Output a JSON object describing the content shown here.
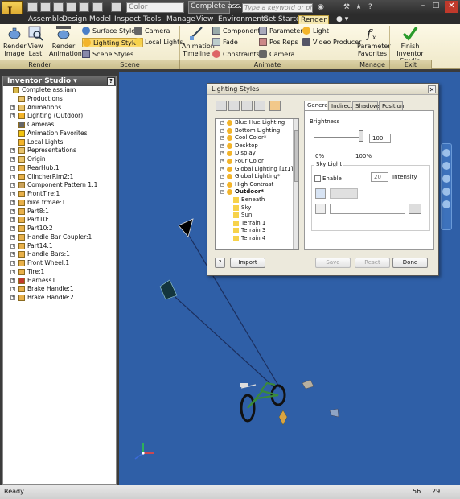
{
  "titlebar": {
    "app_logo": "I",
    "color_dropdown": "Color",
    "document_title": "Complete ass...",
    "search_placeholder": "Type a keyword or phrase",
    "minimize": "–",
    "maximize": "□",
    "close": "✕"
  },
  "tabs": [
    "Assemble",
    "Design",
    "Model",
    "Inspect",
    "Tools",
    "Manage",
    "View",
    "Environments",
    "Get Started",
    "Render"
  ],
  "ribbon": {
    "render_image": [
      "Render",
      "Image"
    ],
    "view_last": [
      "View",
      "Last"
    ],
    "render_animation": [
      "Render",
      "Animation"
    ],
    "surface_styles": "Surface Styles",
    "lighting_styles": "Lighting Styles",
    "scene_styles": "Scene Styles",
    "camera": "Camera",
    "local_lights": "Local Lights",
    "animation_timeline": [
      "Animation",
      "Timeline"
    ],
    "components": "Components",
    "fade": "Fade",
    "constraints": "Constraints",
    "parameters": "Parameters",
    "pos_reps": "Pos Reps",
    "camera2": "Camera",
    "light": "Light",
    "video_producer": "Video Producer",
    "parameter_favorites": [
      "Parameter",
      "Favorites"
    ],
    "finish_inventor_studio": [
      "Finish",
      "Inventor Studio"
    ],
    "groups": [
      "Render",
      "Scene",
      "Animate",
      "Manage",
      "Exit"
    ]
  },
  "browser": {
    "header": "Inventor Studio ▾",
    "help": "?",
    "items": [
      {
        "label": "Complete ass.iam",
        "indent": 0,
        "expander": "",
        "icon": "assembly"
      },
      {
        "label": "Productions",
        "indent": 1,
        "expander": "",
        "icon": "folder"
      },
      {
        "label": "Animations",
        "indent": 1,
        "expander": "+",
        "icon": "folder"
      },
      {
        "label": "Lighting (Outdoor)",
        "indent": 1,
        "expander": "+",
        "icon": "light"
      },
      {
        "label": "Cameras",
        "indent": 1,
        "expander": "",
        "icon": "camera"
      },
      {
        "label": "Animation Favorites",
        "indent": 1,
        "expander": "",
        "icon": "star"
      },
      {
        "label": "Local Lights",
        "indent": 1,
        "expander": "",
        "icon": "light"
      },
      {
        "label": "Representations",
        "indent": 1,
        "expander": "+",
        "icon": "folder"
      },
      {
        "label": "Origin",
        "indent": 1,
        "expander": "+",
        "icon": "folder"
      },
      {
        "label": "RearHub:1",
        "indent": 1,
        "expander": "+",
        "icon": "part"
      },
      {
        "label": "ClincherRim2:1",
        "indent": 1,
        "expander": "+",
        "icon": "part"
      },
      {
        "label": "Component Pattern 1:1",
        "indent": 1,
        "expander": "+",
        "icon": "pattern"
      },
      {
        "label": "FrontTire:1",
        "indent": 1,
        "expander": "+",
        "icon": "part"
      },
      {
        "label": "bike frmae:1",
        "indent": 1,
        "expander": "+",
        "icon": "part"
      },
      {
        "label": "Part8:1",
        "indent": 1,
        "expander": "+",
        "icon": "part"
      },
      {
        "label": "Part10:1",
        "indent": 1,
        "expander": "+",
        "icon": "part"
      },
      {
        "label": "Part10:2",
        "indent": 1,
        "expander": "+",
        "icon": "part"
      },
      {
        "label": "Handle Bar Coupler:1",
        "indent": 1,
        "expander": "+",
        "icon": "part"
      },
      {
        "label": "Part14:1",
        "indent": 1,
        "expander": "+",
        "icon": "part"
      },
      {
        "label": "Handle Bars:1",
        "indent": 1,
        "expander": "+",
        "icon": "part"
      },
      {
        "label": "Front Wheel:1",
        "indent": 1,
        "expander": "+",
        "icon": "part"
      },
      {
        "label": "Tire:1",
        "indent": 1,
        "expander": "+",
        "icon": "part"
      },
      {
        "label": "Harness1",
        "indent": 1,
        "expander": "+",
        "icon": "harness"
      },
      {
        "label": "Brake Handle:1",
        "indent": 1,
        "expander": "+",
        "icon": "part"
      },
      {
        "label": "Brake Handle:2",
        "indent": 1,
        "expander": "+",
        "icon": "part"
      }
    ]
  },
  "dialog": {
    "title": "Lighting Styles",
    "close": "✕",
    "styles": [
      {
        "label": "Blue Hue Lighting",
        "expander": "+",
        "icon": "bulb",
        "indent": 0,
        "bold": false
      },
      {
        "label": "Bottom Lighting",
        "expander": "+",
        "icon": "bulb",
        "indent": 0,
        "bold": false
      },
      {
        "label": "Cool Color*",
        "expander": "+",
        "icon": "bulb",
        "indent": 0,
        "bold": false
      },
      {
        "label": "Desktop",
        "expander": "+",
        "icon": "bulb",
        "indent": 0,
        "bold": false
      },
      {
        "label": "Display",
        "expander": "+",
        "icon": "bulb",
        "indent": 0,
        "bold": false
      },
      {
        "label": "Four Color",
        "expander": "+",
        "icon": "bulb",
        "indent": 0,
        "bold": false
      },
      {
        "label": "Global Lighting [1t1]",
        "expander": "+",
        "icon": "bulb",
        "indent": 0,
        "bold": false
      },
      {
        "label": "Global Lighting*",
        "expander": "+",
        "icon": "bulb",
        "indent": 0,
        "bold": false
      },
      {
        "label": "High Contrast",
        "expander": "+",
        "icon": "bulb",
        "indent": 0,
        "bold": false
      },
      {
        "label": "Outdoor*",
        "expander": "−",
        "icon": "bulb",
        "indent": 0,
        "bold": true
      },
      {
        "label": "Beneath",
        "expander": "",
        "icon": "ray",
        "indent": 1,
        "bold": false
      },
      {
        "label": "Sky",
        "expander": "",
        "icon": "ray",
        "indent": 1,
        "bold": false
      },
      {
        "label": "Sun",
        "expander": "",
        "icon": "ray",
        "indent": 1,
        "bold": false
      },
      {
        "label": "Terrain 1",
        "expander": "",
        "icon": "ray",
        "indent": 1,
        "bold": false
      },
      {
        "label": "Terrain 3",
        "expander": "",
        "icon": "ray",
        "indent": 1,
        "bold": false
      },
      {
        "label": "Terrain 4",
        "expander": "",
        "icon": "ray",
        "indent": 1,
        "bold": false
      }
    ],
    "tabs": [
      "General",
      "Indirect",
      "Shadows",
      "Position"
    ],
    "brightness_label": "Brightness",
    "brightness_value": "100",
    "brightness_level": 1.0,
    "range_min": "0%",
    "range_max": "100%",
    "sky_light_label": "Sky Light",
    "enable_label": "Enable",
    "intensity_value": "20",
    "intensity_label": "Intensity",
    "import_button": "Import",
    "save_button": "Save",
    "reset_button": "Reset",
    "done_button": "Done",
    "help": "?"
  },
  "status": {
    "text": "Ready",
    "value_a": "56",
    "value_b": "29"
  },
  "colors": {
    "viewport": "#2f5fa7",
    "ribbon_active_tab": "#f5e8b0",
    "highlight": "#fbd86a"
  }
}
